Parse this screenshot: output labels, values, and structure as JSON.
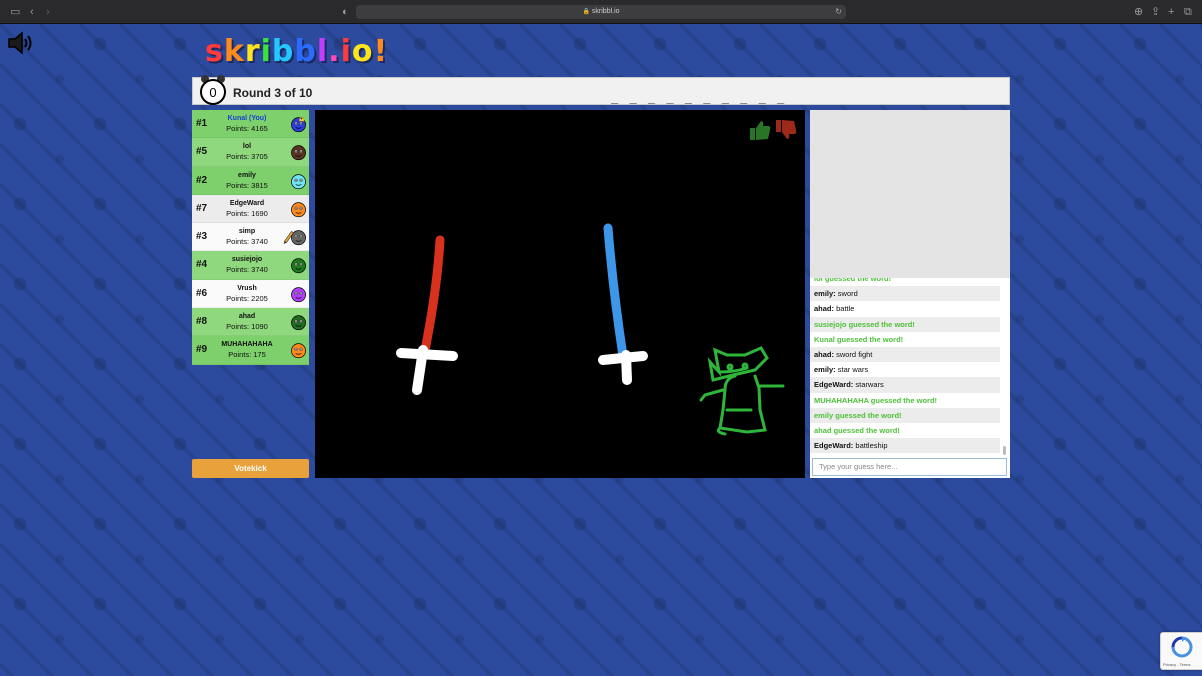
{
  "browser": {
    "url": "skribbl.io"
  },
  "logo": {
    "letters": [
      "s",
      "k",
      "r",
      "i",
      "b",
      "b",
      "l",
      ".",
      "i",
      "o",
      "!"
    ],
    "colors": [
      "#ff3b3b",
      "#ff8a1c",
      "#ffe41c",
      "#3be23b",
      "#24c7ff",
      "#2c6bff",
      "#c23bff",
      "#ff48b8",
      "#ff3b3b",
      "#ffe41c",
      "#ff8a1c"
    ]
  },
  "header": {
    "timer": "0",
    "round": "Round 3 of 10",
    "word_hint": "_ _ _ _ _ _ _ _ _ _"
  },
  "players": [
    {
      "rank": "#1",
      "name": "Kunal (You)",
      "points": "Points: 4165",
      "me": true,
      "guessed": true,
      "color": "#2d3dde",
      "owner": true
    },
    {
      "rank": "#5",
      "name": "lol",
      "points": "Points: 3705",
      "guessed": true,
      "color": "#5a3321"
    },
    {
      "rank": "#2",
      "name": "emily",
      "points": "Points: 3815",
      "guessed": true,
      "color": "#6ee6f5"
    },
    {
      "rank": "#7",
      "name": "EdgeWard",
      "points": "Points: 1690",
      "guessed": false,
      "color": "#ff8a1c"
    },
    {
      "rank": "#3",
      "name": "simp",
      "points": "Points: 3740",
      "guessed": false,
      "color": "#666666",
      "drawing": true
    },
    {
      "rank": "#4",
      "name": "susiejojo",
      "points": "Points: 3740",
      "guessed": true,
      "color": "#1f7a1f"
    },
    {
      "rank": "#6",
      "name": "Vrush",
      "points": "Points: 2205",
      "guessed": false,
      "color": "#b13bff"
    },
    {
      "rank": "#8",
      "name": "ahad",
      "points": "Points: 1090",
      "guessed": true,
      "color": "#226b22"
    },
    {
      "rank": "#9",
      "name": "MUHAHAHAHA",
      "points": "Points: 175",
      "guessed": true,
      "color": "#ff8a1c"
    }
  ],
  "votekick_label": "Votekick",
  "chat": {
    "messages": [
      {
        "text": "lol guessed the word!",
        "system": true
      },
      {
        "author": "emily:",
        "text": " sword"
      },
      {
        "author": "ahad:",
        "text": " battle"
      },
      {
        "text": "susiejojo guessed the word!",
        "system": true
      },
      {
        "text": "Kunal guessed the word!",
        "system": true
      },
      {
        "author": "ahad:",
        "text": " sword fight"
      },
      {
        "author": "emily:",
        "text": " star wars"
      },
      {
        "author": "EdgeWard:",
        "text": " starwars"
      },
      {
        "text": "MUHAHAHAHA guessed the word!",
        "system": true
      },
      {
        "text": "emily guessed the word!",
        "system": true
      },
      {
        "text": "ahad guessed the word!",
        "system": true
      },
      {
        "author": "EdgeWard:",
        "text": " battleship"
      }
    ],
    "placeholder": "Type your guess here..."
  },
  "recaptcha": {
    "text": "Privacy - Terms"
  }
}
